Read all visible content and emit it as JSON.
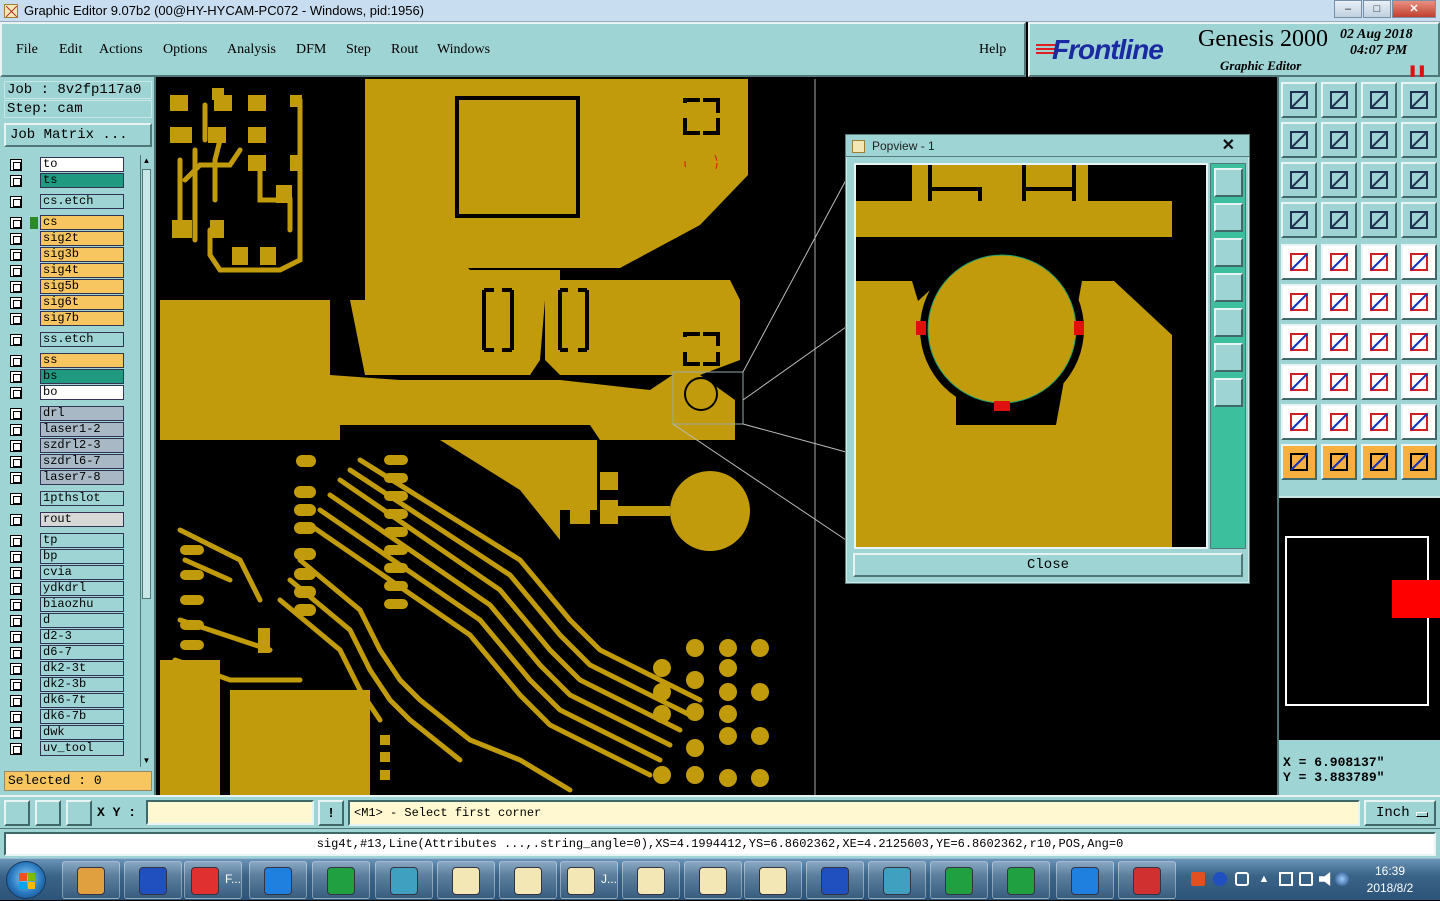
{
  "window": {
    "title": "Graphic Editor 9.07b2 (00@HY-HYCAM-PC072 - Windows, pid:1956)",
    "minimize": "–",
    "maximize": "□",
    "close": "✕"
  },
  "menu": {
    "items": [
      "File",
      "Edit",
      "Actions",
      "Options",
      "Analysis",
      "DFM",
      "Step",
      "Rout",
      "Windows"
    ],
    "help": "Help"
  },
  "brand": {
    "logo": "Frontline",
    "product": "Genesis 2000",
    "subtitle": "Graphic Editor",
    "date": "02 Aug 2018",
    "time": "04:07 PM"
  },
  "job": {
    "job_line": "Job : 8v2fp117a0",
    "step_line": "Step: cam",
    "matrix_button": "Job Matrix ...",
    "selected": "Selected : 0"
  },
  "layers": [
    {
      "name": "to",
      "color": "#ffffff",
      "active": false
    },
    {
      "name": "ts",
      "color": "#1f9a80",
      "active": false
    },
    {
      "name": "cs.etch",
      "color": "#9fd4d4",
      "active": false
    },
    {
      "name": "cs",
      "color": "#f7c660",
      "active": true
    },
    {
      "name": "sig2t",
      "color": "#f7c660",
      "active": false
    },
    {
      "name": "sig3b",
      "color": "#f7c660",
      "active": false
    },
    {
      "name": "sig4t",
      "color": "#f7c660",
      "active": false
    },
    {
      "name": "sig5b",
      "color": "#f7c660",
      "active": false
    },
    {
      "name": "sig6t",
      "color": "#f7c660",
      "active": false
    },
    {
      "name": "sig7b",
      "color": "#f7c660",
      "active": false
    },
    {
      "name": "ss.etch",
      "color": "#9fd4d4",
      "active": false
    },
    {
      "name": "ss",
      "color": "#f7c660",
      "active": false
    },
    {
      "name": "bs",
      "color": "#1f9a80",
      "active": false
    },
    {
      "name": "bo",
      "color": "#ffffff",
      "active": false
    },
    {
      "name": "drl",
      "color": "#a8b8c4",
      "active": false
    },
    {
      "name": "laser1-2",
      "color": "#a8b8c4",
      "active": false
    },
    {
      "name": "szdrl2-3",
      "color": "#a8b8c4",
      "active": false
    },
    {
      "name": "szdrl6-7",
      "color": "#a8b8c4",
      "active": false
    },
    {
      "name": "laser7-8",
      "color": "#a8b8c4",
      "active": false
    },
    {
      "name": "1pthslot",
      "color": "#9fd4d4",
      "active": false
    },
    {
      "name": "rout",
      "color": "#d8d8d8",
      "active": false
    },
    {
      "name": "tp",
      "color": "#9fd4d4",
      "active": false
    },
    {
      "name": "bp",
      "color": "#9fd4d4",
      "active": false
    },
    {
      "name": "cvia",
      "color": "#9fd4d4",
      "active": false
    },
    {
      "name": "ydkdrl",
      "color": "#9fd4d4",
      "active": false
    },
    {
      "name": "biaozhu",
      "color": "#9fd4d4",
      "active": false
    },
    {
      "name": "d",
      "color": "#9fd4d4",
      "active": false
    },
    {
      "name": "d2-3",
      "color": "#9fd4d4",
      "active": false
    },
    {
      "name": "d6-7",
      "color": "#9fd4d4",
      "active": false
    },
    {
      "name": "dk2-3t",
      "color": "#9fd4d4",
      "active": false
    },
    {
      "name": "dk2-3b",
      "color": "#9fd4d4",
      "active": false
    },
    {
      "name": "dk6-7t",
      "color": "#9fd4d4",
      "active": false
    },
    {
      "name": "dk6-7b",
      "color": "#9fd4d4",
      "active": false
    },
    {
      "name": "dwk",
      "color": "#9fd4d4",
      "active": false
    },
    {
      "name": "uv_tool",
      "color": "#9fd4d4",
      "active": false
    }
  ],
  "popview": {
    "title": "Popview - 1",
    "close_label": "Close",
    "close_x": "✕"
  },
  "coords": {
    "x": "X = 6.908137\"",
    "y": "Y = 3.883789\""
  },
  "command": {
    "xy_label": "X Y :",
    "xy_value": "",
    "warn": "!",
    "prompt": "<M1> - Select first corner",
    "units": "Inch"
  },
  "info": {
    "feature": "sig4t,#13,Line(Attributes ...,.string_angle=0),XS=4.1994412,YS=6.8602362,XE=4.2125603,YE=6.8602362,r10,POS,Ang=0"
  },
  "taskbar": {
    "tasks": [
      "shell",
      "save",
      "F...",
      "ie",
      "frontline",
      "eye",
      "genesis1",
      "genesis2",
      "J...",
      "genesis4",
      "genesis5",
      "genesis6",
      "word",
      "eye2",
      "excel",
      "excel2",
      "qq",
      "pdf"
    ],
    "task_label_f": "F...",
    "task_label_j": "J...",
    "clock_time": "16:39",
    "clock_date": "2018/8/2"
  },
  "colors": {
    "copper": "#c29b0c",
    "panel": "#9fd4d4",
    "accent_red": "#e01010"
  }
}
